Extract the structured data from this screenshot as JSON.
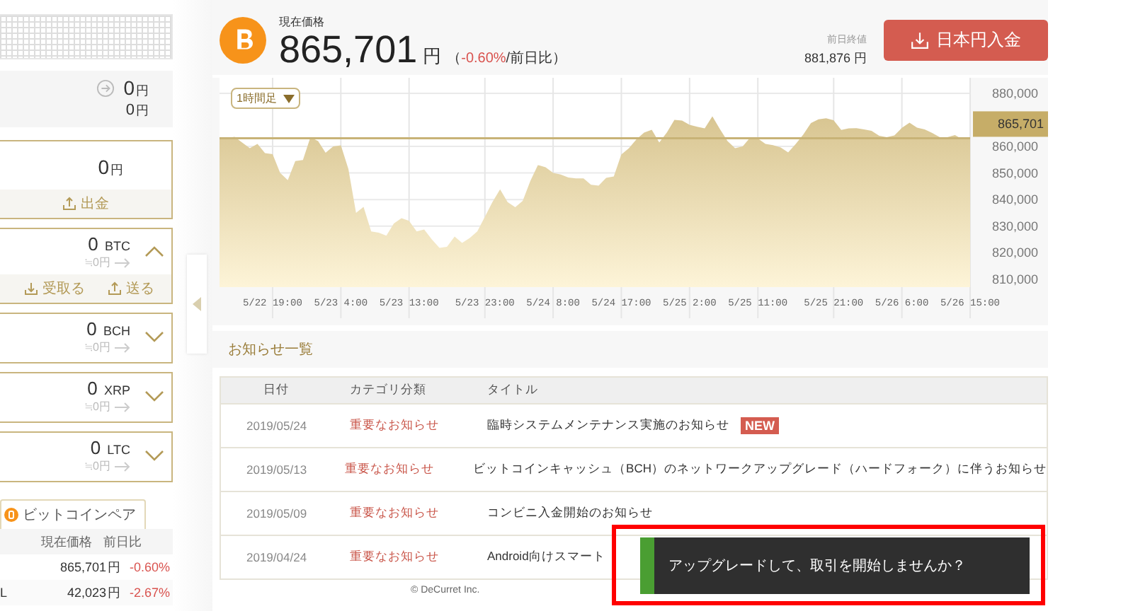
{
  "sidebar": {
    "summary": {
      "amount": "0",
      "unit": "円",
      "sub_amount": "0",
      "sub_unit": "円"
    },
    "jpy_card": {
      "amount": "0",
      "unit": "円",
      "action": "出金"
    },
    "assets": [
      {
        "amount": "0",
        "unit": "BTC",
        "jpy": "≒0円",
        "expanded": true,
        "actions": [
          "受取る",
          "送る"
        ]
      },
      {
        "amount": "0",
        "unit": "BCH",
        "jpy": "≒0円",
        "expanded": false
      },
      {
        "amount": "0",
        "unit": "XRP",
        "jpy": "≒0円",
        "expanded": false
      },
      {
        "amount": "0",
        "unit": "LTC",
        "jpy": "≒0円",
        "expanded": false
      }
    ],
    "pair_tab": {
      "label": "ビットコインペア",
      "selected": true
    },
    "pair_table": {
      "columns": [
        "現在価格",
        "前日比"
      ],
      "rows": [
        {
          "price": "865,701",
          "unit": "円",
          "change": "-0.60%"
        },
        {
          "pair_fragment": "L",
          "price": "42,023",
          "unit": "円",
          "change": "-2.67%"
        }
      ]
    }
  },
  "header": {
    "label": "現在価格",
    "price": "865,701",
    "unit": "円",
    "change_prefix": "（",
    "change": "-0.60%",
    "change_suffix": "/前日比）",
    "prev_close": {
      "label": "前日終値",
      "value": "881,876 円"
    },
    "deposit_button": "日本円入金"
  },
  "chart": {
    "interval": "1時間足",
    "chart_data": {
      "type": "area",
      "categories": [
        null,
        null,
        null,
        null,
        null,
        null,
        null,
        "5/22 19:00",
        null,
        null,
        null,
        null,
        null,
        null,
        null,
        null,
        "5/23 4:00",
        null,
        null,
        null,
        null,
        null,
        null,
        null,
        null,
        "5/23 13:00",
        null,
        null,
        null,
        null,
        null,
        null,
        null,
        null,
        null,
        "5/23 23:00",
        null,
        null,
        null,
        null,
        null,
        null,
        null,
        null,
        "5/24 8:00",
        null,
        null,
        null,
        null,
        null,
        null,
        null,
        null,
        "5/24 17:00",
        null,
        null,
        null,
        null,
        null,
        null,
        null,
        null,
        "5/25 2:00",
        null,
        null,
        null,
        null,
        null,
        null,
        null,
        null,
        "5/25 11:00",
        null,
        null,
        null,
        null,
        null,
        null,
        null,
        null,
        null,
        "5/25 21:00",
        null,
        null,
        null,
        null,
        null,
        null,
        null,
        null,
        "5/26 6:00",
        null,
        null,
        null,
        null,
        null,
        null,
        null,
        null,
        "5/26 15:00"
      ],
      "series": [
        {
          "color": "#d8c591",
          "values": [
            862700,
            863200,
            863600,
            861400,
            859300,
            860900,
            857500,
            857100,
            850000,
            847300,
            854500,
            854900,
            863500,
            862000,
            857600,
            860000,
            860400,
            851500,
            835000,
            837200,
            828000,
            827500,
            826400,
            831000,
            833000,
            832000,
            828000,
            828700,
            825000,
            821800,
            822200,
            826000,
            823700,
            825500,
            828000,
            833500,
            839000,
            843800,
            839000,
            837100,
            839500,
            847000,
            853000,
            852200,
            850000,
            849400,
            848300,
            848000,
            848000,
            845600,
            845200,
            848200,
            848700,
            857000,
            859400,
            862700,
            865200,
            866300,
            861500,
            865300,
            870000,
            869700,
            868100,
            867400,
            866800,
            871300,
            866500,
            862000,
            859400,
            860000,
            863400,
            863000,
            861000,
            860500,
            859600,
            857800,
            861000,
            864500,
            868800,
            870200,
            870600,
            869900,
            866200,
            866800,
            866900,
            866400,
            865900,
            864000,
            863500,
            864200,
            867000,
            868900,
            867100,
            866400,
            865100,
            863500,
            863500,
            864300,
            862700,
            863100
          ]
        }
      ],
      "ylim": [
        807000,
        880000
      ],
      "grid": true,
      "yticks": [
        {
          "value": 810000,
          "label": "810,000"
        },
        {
          "value": 820000,
          "label": "820,000"
        },
        {
          "value": 830000,
          "label": "830,000"
        },
        {
          "value": 840000,
          "label": "840,000"
        },
        {
          "value": 850000,
          "label": "850,000"
        },
        {
          "value": 860000,
          "label": "860,000"
        },
        {
          "value": 880000,
          "label": "880,000"
        }
      ],
      "annotations": [
        "865,701"
      ]
    }
  },
  "notices": {
    "title": "お知らせ一覧",
    "columns": [
      "日付",
      "カテゴリ分類",
      "タイトル"
    ],
    "rows": [
      {
        "date": "2019/05/24",
        "category": "重要なお知らせ",
        "title": "臨時システムメンテナンス実施のお知らせ",
        "new": true,
        "badge": "NEW"
      },
      {
        "date": "2019/05/13",
        "category": "重要なお知らせ",
        "title": "ビットコインキャッシュ（BCH）のネットワークアップグレード（ハードフォーク）に伴うお知らせ",
        "new": false
      },
      {
        "date": "2019/05/09",
        "category": "重要なお知らせ",
        "title": "コンビニ入金開始のお知らせ",
        "new": false
      },
      {
        "date": "2019/04/24",
        "category": "重要なお知らせ",
        "title": "Android向けスマート",
        "new": false
      }
    ]
  },
  "footer": "© DeCurret Inc.",
  "toast": {
    "message": "アップグレードして、取引を開始しませんか？",
    "highlighted": true
  }
}
